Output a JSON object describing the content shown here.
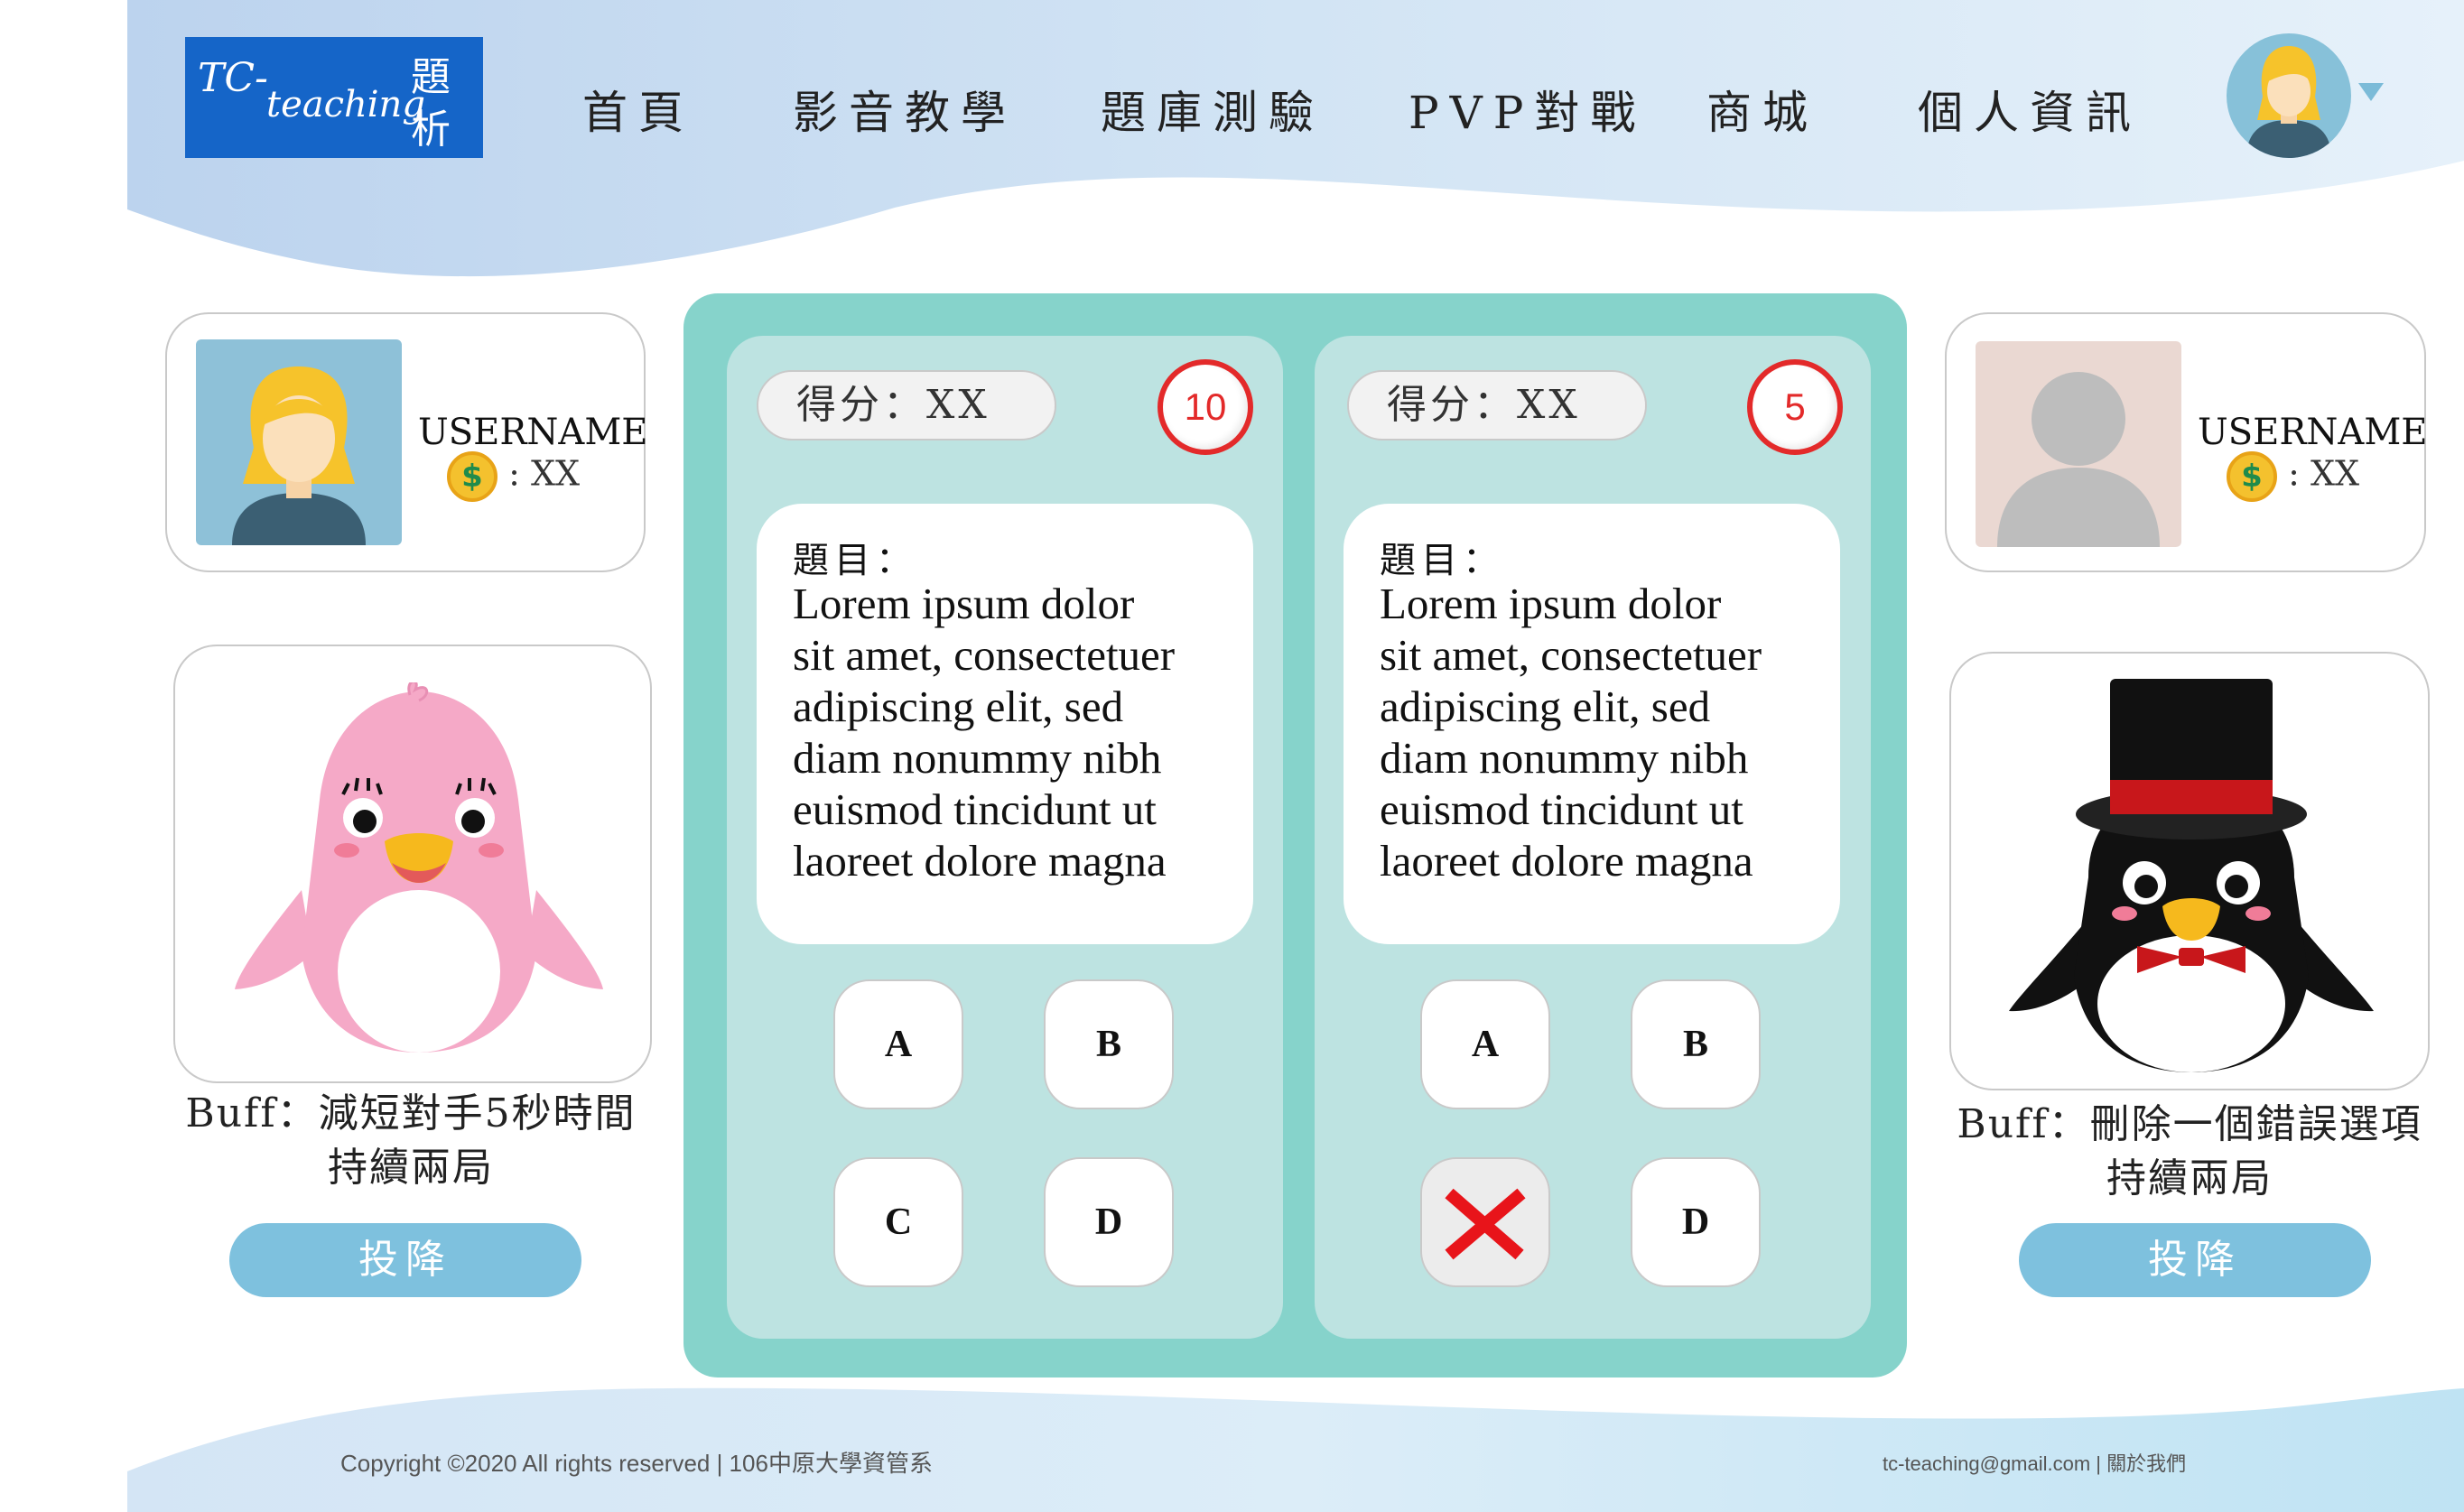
{
  "header": {
    "logo": {
      "tc": "TC-",
      "teaching": "teaching",
      "ti": "題",
      "xi": "析"
    },
    "nav": [
      "首頁",
      "影音教學",
      "題庫測驗",
      "PVP對戰",
      "商城",
      "個人資訊"
    ],
    "avatar_icon": "user-avatar-icon"
  },
  "player_left": {
    "username": "USERNAME",
    "coin_symbol": "$",
    "coins": ":  XX",
    "buff_line1": "Buff：減短對手5秒時間",
    "buff_line2": "持續兩局",
    "surrender": "投降",
    "character": "pink-penguin"
  },
  "player_right": {
    "username": "USERNAME",
    "coin_symbol": "$",
    "coins": ":  XX",
    "buff_line1": "Buff：刪除一個錯誤選項",
    "buff_line2": "持續兩局",
    "surrender": "投降",
    "character": "top-hat-penguin"
  },
  "panel_left": {
    "score": "得分：XX",
    "timer": "10",
    "question_label": "題目：",
    "question_lines": [
      "Lorem ipsum dolor",
      "sit amet, consectetuer",
      "adipiscing elit, sed",
      "diam nonummy nibh",
      "euismod tincidunt ut",
      "laoreet dolore magna"
    ],
    "options": [
      "A",
      "B",
      "C",
      "D"
    ]
  },
  "panel_right": {
    "score": "得分：XX",
    "timer": "5",
    "question_label": "題目：",
    "question_lines": [
      "Lorem ipsum dolor",
      "sit amet, consectetuer",
      "adipiscing elit, sed",
      "diam nonummy nibh",
      "euismod tincidunt ut",
      "laoreet dolore magna"
    ],
    "options": [
      "A",
      "B",
      "",
      "D"
    ],
    "removed_option_icon": "x-mark-icon"
  },
  "footer": {
    "copyright": "Copyright ©2020 All rights reserved  |  106中原大學資管系",
    "contact": "tc-teaching@gmail.com  |  關於我們"
  },
  "colors": {
    "header_wave": "#c6dcf2",
    "logo_bg": "#1565c8",
    "board": "#86d3cb",
    "panel": "#bde3e1",
    "surrender": "#7ec1de",
    "timer_red": "#e32a2a",
    "wrong_x": "#e8141a"
  }
}
